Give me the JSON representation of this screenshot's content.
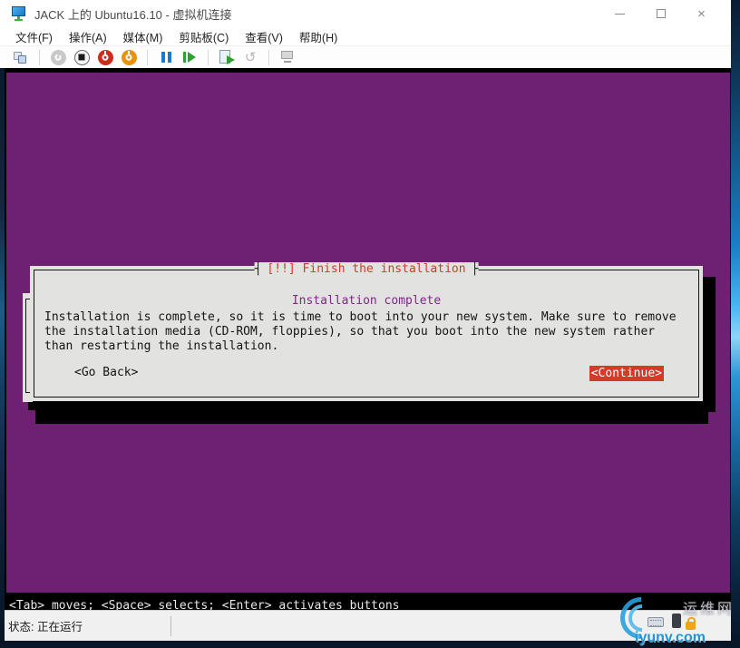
{
  "window": {
    "title": "JACK 上的 Ubuntu16.10 - 虚拟机连接",
    "controls": [
      "minimize",
      "maximize",
      "close"
    ]
  },
  "menu": {
    "items": [
      "文件(F)",
      "操作(A)",
      "媒体(M)",
      "剪贴板(C)",
      "查看(V)",
      "帮助(H)"
    ]
  },
  "toolbar": {
    "icons": [
      "ctrl-alt-del",
      "start",
      "turn-off",
      "shut-down",
      "save",
      "pause",
      "resume",
      "checkpoint",
      "revert",
      "enhanced-session"
    ]
  },
  "installer": {
    "dialog_title": "[!!] Finish the installation",
    "heading": "Installation complete",
    "body_lines": [
      "Installation is complete, so it is time to boot into your new system. Make sure to remove",
      "the installation media (CD-ROM, floppies), so that you boot into the new system rather",
      "than restarting the installation."
    ],
    "go_back_label": "<Go Back>",
    "continue_label": "<Continue>",
    "title_tick_left": "┤",
    "title_tick_right": "├",
    "help_line": "<Tab> moves; <Space> selects; <Enter> activates buttons",
    "colors": {
      "screen_bg": "#6e2173",
      "dialog_bg": "#e2e2e0",
      "title_red": "#d33b27",
      "heading_purple": "#7a2a80",
      "continue_bg": "#d33b27",
      "help_strip_bg": "#000000"
    }
  },
  "status_bar": {
    "text": "状态: 正在运行"
  },
  "watermark": {
    "site": "运维网",
    "domain": "iyunv.com"
  }
}
